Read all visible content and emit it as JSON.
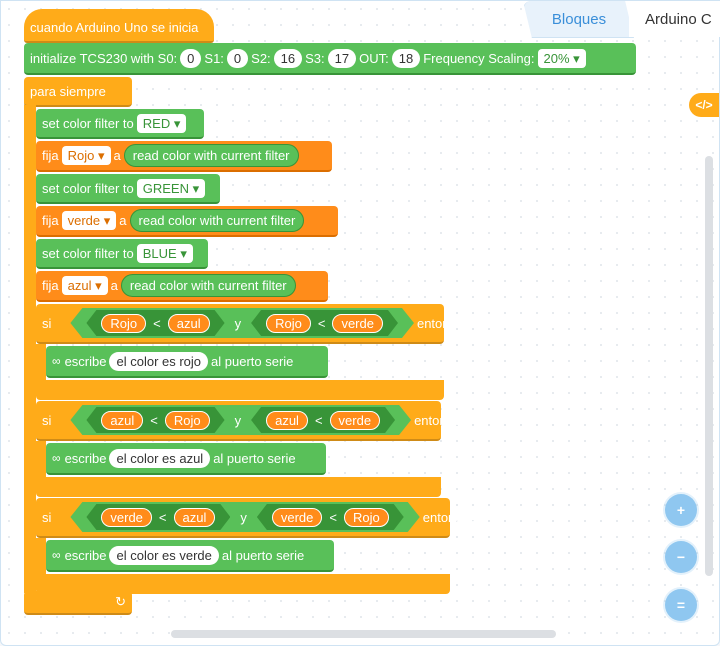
{
  "tabs": {
    "blocks": "Bloques",
    "arduino": "Arduino C"
  },
  "hat": {
    "label": "cuando Arduino Uno se inicia"
  },
  "init": {
    "label": "initialize TCS230 with S0:",
    "s0": "0",
    "s1_label": "S1:",
    "s1": "0",
    "s2_label": "S2:",
    "s2": "16",
    "s3_label": "S3:",
    "s3": "17",
    "out_label": "OUT:",
    "out": "18",
    "freq_label": "Frequency Scaling:",
    "freq": "20% ▾"
  },
  "forever": {
    "label": "para siempre"
  },
  "filters": [
    {
      "label": "set color filter to",
      "value": "RED ▾"
    },
    {
      "label": "set color filter to",
      "value": "GREEN ▾"
    },
    {
      "label": "set color filter to",
      "value": "BLUE ▾"
    }
  ],
  "sets": [
    {
      "label": "fija",
      "var": "Rojo ▾",
      "a": "a",
      "reporter": "read color with current filter"
    },
    {
      "label": "fija",
      "var": "verde ▾",
      "a": "a",
      "reporter": "read color with current filter"
    },
    {
      "label": "fija",
      "var": "azul ▾",
      "a": "a",
      "reporter": "read color with current filter"
    }
  ],
  "ifs": [
    {
      "si": "si",
      "a1": "Rojo",
      "op1": "<",
      "b1": "azul",
      "and": "y",
      "a2": "Rojo",
      "op2": "<",
      "b2": "verde",
      "then": "entonces",
      "print": "escribe",
      "message": "el color es rojo",
      "suffix": "al puerto serie"
    },
    {
      "si": "si",
      "a1": "azul",
      "op1": "<",
      "b1": "Rojo",
      "and": "y",
      "a2": "azul",
      "op2": "<",
      "b2": "verde",
      "then": "entonces",
      "print": "escribe",
      "message": "el color es azul",
      "suffix": "al puerto serie"
    },
    {
      "si": "si",
      "a1": "verde",
      "op1": "<",
      "b1": "azul",
      "and": "y",
      "a2": "verde",
      "op2": "<",
      "b2": "Rojo",
      "then": "entonces",
      "print": "escribe",
      "message": "el color es verde",
      "suffix": "al puerto serie"
    }
  ],
  "icons": {
    "code": "</>",
    "zoom_in": "+",
    "zoom_out": "−",
    "reset": "=",
    "serial": "∞",
    "loop_arrow": "↻"
  },
  "colors": {
    "events": "#ffab19",
    "sensor": "#59c059",
    "variables": "#ff8c1a",
    "tab_active": "#3a8fd9"
  }
}
